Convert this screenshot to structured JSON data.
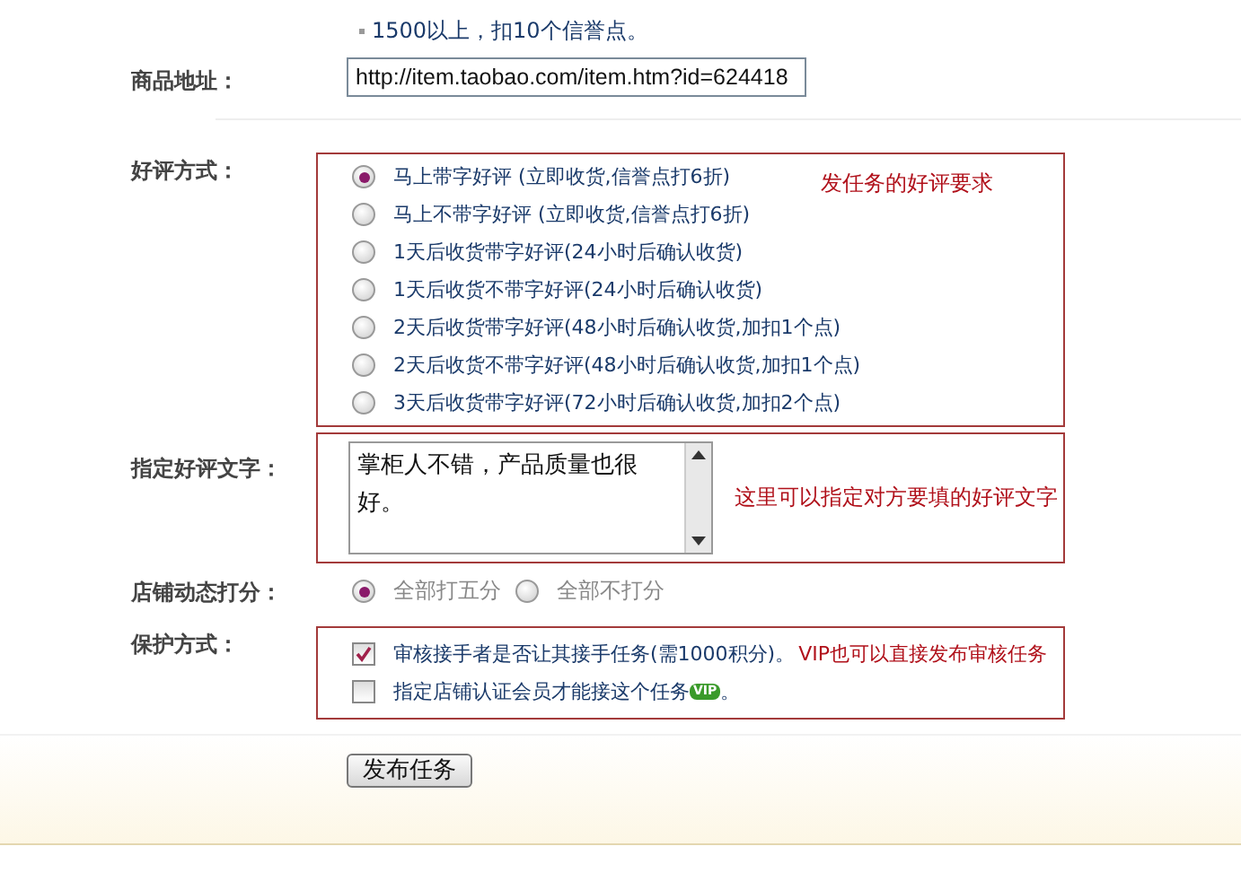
{
  "notes": [
    "1500以上，扣10个信誉点。"
  ],
  "item_url": {
    "label": "商品地址：",
    "value": "http://item.taobao.com/item.htm?id=624418"
  },
  "review_method": {
    "label": "好评方式：",
    "hint": "发任务的好评要求",
    "options": [
      {
        "label": "马上带字好评 (立即收货,信誉点打6折)",
        "selected": true
      },
      {
        "label": "马上不带字好评 (立即收货,信誉点打6折)",
        "selected": false
      },
      {
        "label": "1天后收货带字好评(24小时后确认收货)",
        "selected": false
      },
      {
        "label": "1天后收货不带字好评(24小时后确认收货)",
        "selected": false
      },
      {
        "label": "2天后收货带字好评(48小时后确认收货,加扣1个点)",
        "selected": false
      },
      {
        "label": "2天后收货不带字好评(48小时后确认收货,加扣1个点)",
        "selected": false
      },
      {
        "label": "3天后收货带字好评(72小时后确认收货,加扣2个点)",
        "selected": false
      }
    ]
  },
  "review_text": {
    "label": "指定好评文字：",
    "value": "掌柜人不错，产品质量也很好。",
    "hint": "这里可以指定对方要填的好评文字"
  },
  "shop_rating": {
    "label": "店铺动态打分：",
    "options": [
      {
        "label": "全部打五分",
        "selected": true
      },
      {
        "label": "全部不打分",
        "selected": false
      }
    ]
  },
  "protection": {
    "label": "保护方式：",
    "options": [
      {
        "label": "审核接手者是否让其接手任务(需1000积分)。",
        "checked": true,
        "note": "VIP也可以直接发布审核任务"
      },
      {
        "label": "指定店铺认证会员才能接这个任务",
        "checked": false,
        "badge": "VIP",
        "suffix": "。"
      }
    ]
  },
  "submit": "发布任务"
}
